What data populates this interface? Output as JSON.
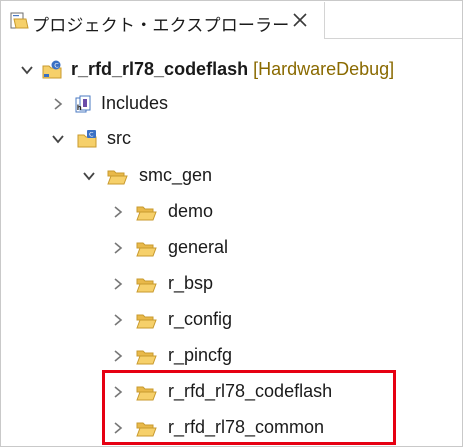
{
  "tab": {
    "title": "プロジェクト・エクスプローラー",
    "icon": "project-explorer-icon",
    "close_icon": "close-icon"
  },
  "tree": {
    "project": {
      "label": "r_rfd_rl78_codeflash",
      "decoration": "[HardwareDebug]",
      "expanded": true
    },
    "includes": {
      "label": "Includes",
      "expanded": false
    },
    "src": {
      "label": "src",
      "expanded": true
    },
    "smc_gen": {
      "label": "smc_gen",
      "expanded": true
    },
    "folders": [
      {
        "label": "demo"
      },
      {
        "label": "general"
      },
      {
        "label": "r_bsp"
      },
      {
        "label": "r_config"
      },
      {
        "label": "r_pincfg"
      },
      {
        "label": "r_rfd_rl78_codeflash"
      },
      {
        "label": "r_rfd_rl78_common"
      }
    ]
  },
  "colors": {
    "highlight_border": "#e60012",
    "folder_fill": "#f6d06a",
    "folder_stroke": "#c89a2e",
    "decoration_text": "#8a6a00"
  }
}
